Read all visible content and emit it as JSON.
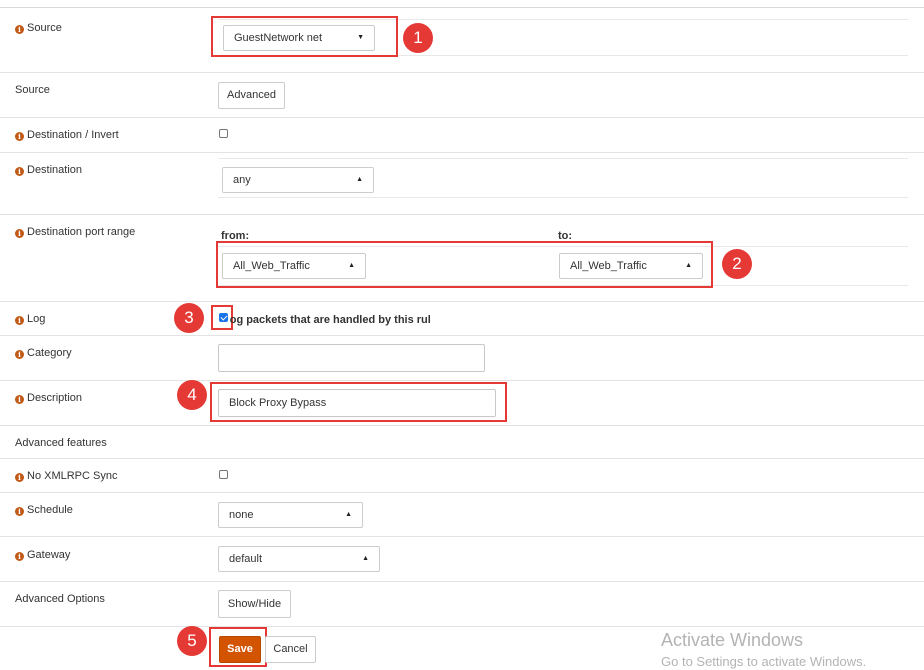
{
  "rows": {
    "source_network": {
      "label": "Source",
      "select_value": "GuestNetwork net",
      "badge": "1"
    },
    "source_advanced": {
      "label": "Source",
      "button_label": "Advanced"
    },
    "destination_invert": {
      "label": "Destination / Invert",
      "checked": false
    },
    "destination": {
      "label": "Destination",
      "select_value": "any"
    },
    "dest_port_range": {
      "label": "Destination port range",
      "from_label": "from:",
      "to_label": "to:",
      "from_value": "All_Web_Traffic",
      "to_value": "All_Web_Traffic",
      "badge": "2"
    },
    "log": {
      "label": "Log",
      "checkbox_text": "Log packets that are handled by this rule",
      "checked": true,
      "badge": "3"
    },
    "category": {
      "label": "Category",
      "value": ""
    },
    "description": {
      "label": "Description",
      "value": "Block Proxy Bypass",
      "badge": "4"
    },
    "advanced_features": {
      "label": "Advanced features"
    },
    "no_xmlrpc": {
      "label": "No XMLRPC Sync",
      "checked": false
    },
    "schedule": {
      "label": "Schedule",
      "select_value": "none"
    },
    "gateway": {
      "label": "Gateway",
      "select_value": "default"
    },
    "advanced_options": {
      "label": "Advanced Options",
      "button_label": "Show/Hide"
    }
  },
  "actions": {
    "save_label": "Save",
    "cancel_label": "Cancel",
    "badge": "5"
  },
  "watermark": {
    "line1": "Activate Windows",
    "line2": "Go to Settings to activate Windows."
  },
  "colors": {
    "info_icon": "#c15a16",
    "highlight": "#e53935",
    "save_button": "#d35400"
  },
  "icons": {
    "info": "info-circle-icon",
    "caret_down": "caret-down-icon",
    "caret_up": "caret-up-icon"
  }
}
